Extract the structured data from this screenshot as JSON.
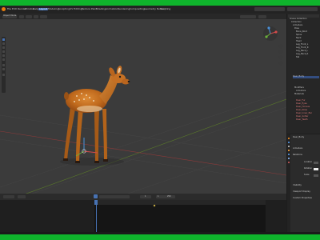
{
  "menu": {
    "items": [
      "File",
      "Edit",
      "Render",
      "Window",
      "Help"
    ],
    "tabs": [
      "Layout",
      "Modeling",
      "Sculpting",
      "UV Editing",
      "Texture Paint",
      "Shading",
      "Animation",
      "Rendering",
      "Compositing",
      "Geometry Nodes",
      "Scripting"
    ],
    "active_tab": "Layout"
  },
  "viewport": {
    "object": "deer-model",
    "mode": "Object Mode"
  },
  "outliner": {
    "rows": [
      "Scene Collection",
      "Collection",
      "Armature",
      "Pose",
      "Bone_Root",
      "Spine",
      "Neck",
      "Head",
      "Leg_Front_L",
      "Leg_Front_R",
      "Leg_Back_L",
      "Leg_Back_R",
      "Tail",
      "Deer_Body",
      "Modifiers",
      "Armature",
      "Materials",
      "Deer_Fur",
      "Deer_Eyes",
      "Deer_Hooves",
      "Deer_Nose",
      "Deer_Inner_Ear",
      "Deer_Antler",
      "Deer_Teeth"
    ],
    "selected_index": 13
  },
  "properties": {
    "title": "Deer_Body",
    "sections": [
      "Armature",
      "Relations",
      "Visibility",
      "Viewport Display",
      "Custom Properties"
    ],
    "fields": [
      "Location",
      "Rotation",
      "Scale"
    ]
  },
  "timeline": {
    "current_frame": "1",
    "start": "1",
    "end": "250"
  },
  "colors": {
    "frame_green": "#0fb42c",
    "accent_blue": "#4772b3",
    "deer_body": "#c06a1d"
  }
}
